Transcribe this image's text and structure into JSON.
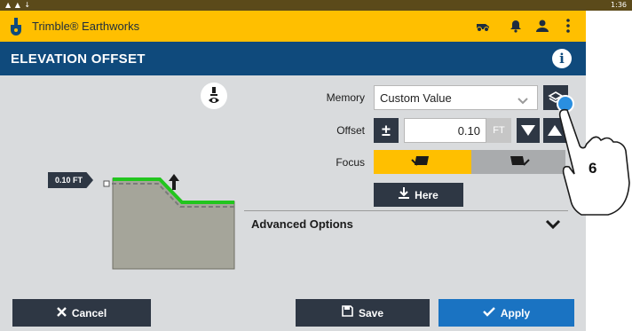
{
  "status_bar": {
    "left": "▲ ▲ ↓",
    "time": "1:36"
  },
  "app_bar": {
    "title": "Trimble® Earthworks",
    "icons": [
      "truck-icon",
      "bell-icon",
      "user-icon",
      "more-icon"
    ]
  },
  "header": {
    "title": "ELEVATION OFFSET",
    "info_icon": "i"
  },
  "form": {
    "memory": {
      "label": "Memory",
      "value": "Custom Value"
    },
    "offset": {
      "label": "Offset",
      "value": "0.10",
      "unit": "FT",
      "sign": "±"
    },
    "focus": {
      "label": "Focus"
    },
    "here": {
      "label": "Here"
    },
    "advanced": {
      "label": "Advanced Options"
    }
  },
  "diagram": {
    "tag": "0.10 FT"
  },
  "footer": {
    "cancel": "Cancel",
    "save": "Save",
    "apply": "Apply"
  },
  "annotation": {
    "step": "6"
  },
  "colors": {
    "brand_yellow": "#ffbf00",
    "header_blue": "#0f4a7c",
    "apply_blue": "#1a73c2",
    "surface_green": "#22c51e"
  }
}
